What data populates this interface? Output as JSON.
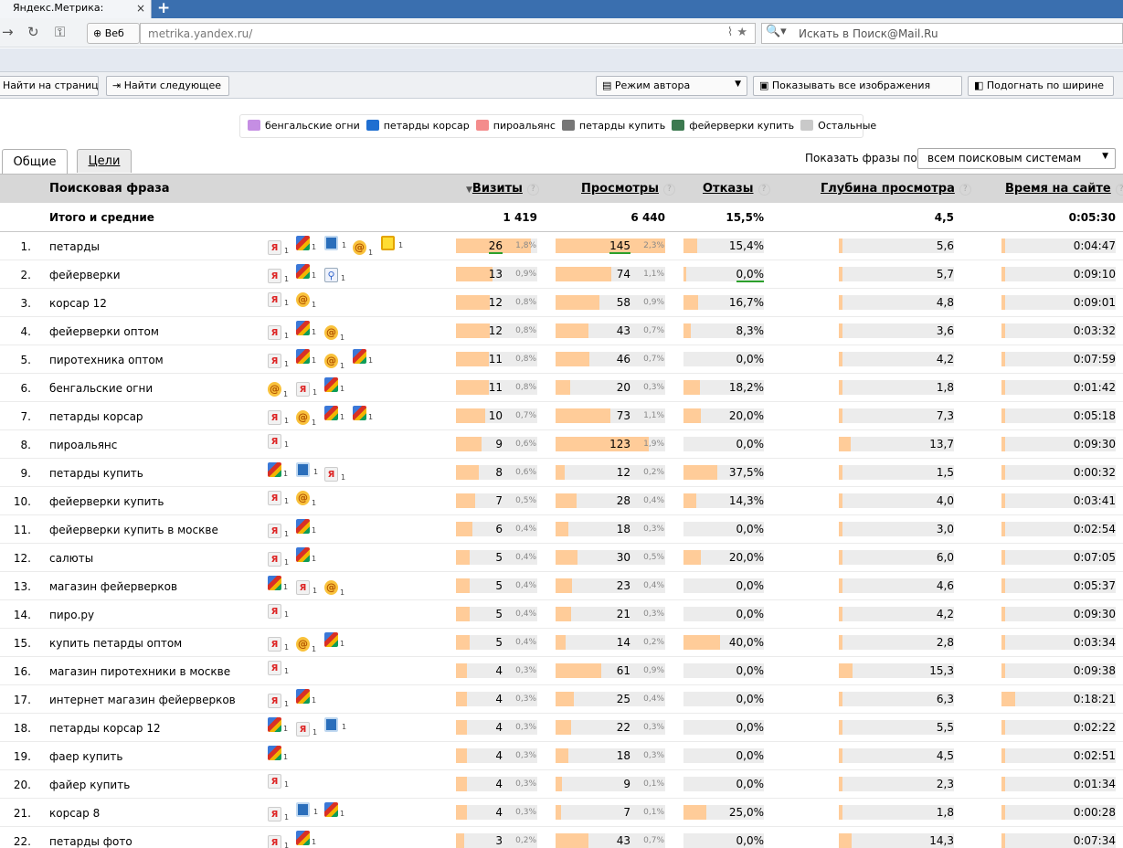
{
  "browser": {
    "tab_title": "Яндекс.Метрика:",
    "tab_close": "×",
    "new_tab": "+",
    "web_button": "Веб",
    "url": "metrika.yandex.ru/",
    "search_placeholder": "Искать в Поиск@Mail.Ru",
    "icons": [
      "forward-icon",
      "reload-icon",
      "key-icon",
      "globe-icon",
      "rss-icon",
      "star-icon",
      "mail-search-icon"
    ]
  },
  "findbar": {
    "input_placeholder": "Найти на странице",
    "find_next": "Найти следующее",
    "author_mode": "Режим автора",
    "show_images": "Показывать все изображения",
    "fit_width": "Подогнать по ширине"
  },
  "legend": [
    {
      "label": "бенгальские огни",
      "color": "#c58ee3"
    },
    {
      "label": "петарды корсар",
      "color": "#1f6fd1"
    },
    {
      "label": "пироальянс",
      "color": "#f48c8c"
    },
    {
      "label": "петарды купить",
      "color": "#777777"
    },
    {
      "label": "фейерверки купить",
      "color": "#3c7a50"
    },
    {
      "label": "Остальные",
      "color": "#c9c9c9"
    }
  ],
  "tabs": {
    "general": "Общие",
    "goals": "Цели"
  },
  "show_phrases": {
    "label": "Показать фразы по",
    "value": "всем поисковым системам"
  },
  "columns": {
    "phrase": "Поисковая фраза",
    "visits": "Визиты",
    "visits_sort": "▼",
    "views": "Просмотры",
    "bounces": "Отказы",
    "depth": "Глубина просмотра",
    "time": "Время на сайте",
    "help": "?"
  },
  "totals": {
    "label": "Итого и средние",
    "visits": "1 419",
    "views": "6 440",
    "bounces": "15,5%",
    "depth": "4,5",
    "time": "0:05:30"
  },
  "rows": [
    {
      "n": "1.",
      "phrase": "петарды",
      "engines": [
        [
          "ya",
          "1"
        ],
        [
          "g",
          "1"
        ],
        [
          "b",
          "1"
        ],
        [
          "m",
          "1"
        ],
        [
          "y",
          "1"
        ]
      ],
      "visits": "26",
      "vp": "1,8%",
      "vf": 0.92,
      "views": "145",
      "wp": "2,3%",
      "wf": 1.0,
      "bounces": "15,4%",
      "bf": 0.17,
      "depth": "5,6",
      "df": 0.03,
      "time": "0:04:47",
      "tf": 0.03,
      "ul": true
    },
    {
      "n": "2.",
      "phrase": "фейерверки",
      "engines": [
        [
          "ya",
          "1"
        ],
        [
          "g",
          "1"
        ],
        [
          "l",
          "1"
        ]
      ],
      "visits": "13",
      "vp": "0,9%",
      "vf": 0.45,
      "views": "74",
      "wp": "1,1%",
      "wf": 0.51,
      "bounces": "0,0%",
      "bf": 0.02,
      "depth": "5,7",
      "df": 0.03,
      "time": "0:09:10",
      "tf": 0.03,
      "ub": true
    },
    {
      "n": "3.",
      "phrase": "корсар 12",
      "engines": [
        [
          "ya",
          "1"
        ],
        [
          "m",
          "1"
        ]
      ],
      "visits": "12",
      "vp": "0,8%",
      "vf": 0.42,
      "views": "58",
      "wp": "0,9%",
      "wf": 0.4,
      "bounces": "16,7%",
      "bf": 0.18,
      "depth": "4,8",
      "df": 0.03,
      "time": "0:09:01",
      "tf": 0.03
    },
    {
      "n": "4.",
      "phrase": "фейерверки оптом",
      "engines": [
        [
          "ya",
          "1"
        ],
        [
          "g",
          "1"
        ],
        [
          "m",
          "1"
        ]
      ],
      "visits": "12",
      "vp": "0,8%",
      "vf": 0.42,
      "views": "43",
      "wp": "0,7%",
      "wf": 0.3,
      "bounces": "8,3%",
      "bf": 0.09,
      "depth": "3,6",
      "df": 0.03,
      "time": "0:03:32",
      "tf": 0.03
    },
    {
      "n": "5.",
      "phrase": "пиротехника оптом",
      "engines": [
        [
          "ya",
          "1"
        ],
        [
          "g",
          "1"
        ],
        [
          "m",
          "1"
        ],
        [
          "g",
          "1"
        ]
      ],
      "visits": "11",
      "vp": "0,8%",
      "vf": 0.4,
      "views": "46",
      "wp": "0,7%",
      "wf": 0.31,
      "bounces": "0,0%",
      "bf": 0.0,
      "depth": "4,2",
      "df": 0.03,
      "time": "0:07:59",
      "tf": 0.03
    },
    {
      "n": "6.",
      "phrase": "бенгальские огни",
      "engines": [
        [
          "m",
          "1"
        ],
        [
          "ya",
          "1"
        ],
        [
          "g",
          "1"
        ]
      ],
      "visits": "11",
      "vp": "0,8%",
      "vf": 0.4,
      "views": "20",
      "wp": "0,3%",
      "wf": 0.13,
      "bounces": "18,2%",
      "bf": 0.2,
      "depth": "1,8",
      "df": 0.03,
      "time": "0:01:42",
      "tf": 0.03
    },
    {
      "n": "7.",
      "phrase": "петарды корсар",
      "engines": [
        [
          "ya",
          "1"
        ],
        [
          "m",
          "1"
        ],
        [
          "g",
          "1"
        ],
        [
          "g",
          "1"
        ]
      ],
      "visits": "10",
      "vp": "0,7%",
      "vf": 0.36,
      "views": "73",
      "wp": "1,1%",
      "wf": 0.5,
      "bounces": "20,0%",
      "bf": 0.22,
      "depth": "7,3",
      "df": 0.03,
      "time": "0:05:18",
      "tf": 0.03
    },
    {
      "n": "8.",
      "phrase": "пироальянс",
      "engines": [
        [
          "ya",
          "1"
        ]
      ],
      "visits": "9",
      "vp": "0,6%",
      "vf": 0.31,
      "views": "123",
      "wp": "1,9%",
      "wf": 0.85,
      "bounces": "0,0%",
      "bf": 0.0,
      "depth": "13,7",
      "df": 0.1,
      "time": "0:09:30",
      "tf": 0.03
    },
    {
      "n": "9.",
      "phrase": "петарды купить",
      "engines": [
        [
          "g",
          "1"
        ],
        [
          "b",
          "1"
        ],
        [
          "ya",
          "1"
        ]
      ],
      "visits": "8",
      "vp": "0,6%",
      "vf": 0.28,
      "views": "12",
      "wp": "0,2%",
      "wf": 0.08,
      "bounces": "37,5%",
      "bf": 0.42,
      "depth": "1,5",
      "df": 0.03,
      "time": "0:00:32",
      "tf": 0.03
    },
    {
      "n": "10.",
      "phrase": "фейерверки купить",
      "engines": [
        [
          "ya",
          "1"
        ],
        [
          "m",
          "1"
        ]
      ],
      "visits": "7",
      "vp": "0,5%",
      "vf": 0.24,
      "views": "28",
      "wp": "0,4%",
      "wf": 0.19,
      "bounces": "14,3%",
      "bf": 0.16,
      "depth": "4,0",
      "df": 0.03,
      "time": "0:03:41",
      "tf": 0.03
    },
    {
      "n": "11.",
      "phrase": "фейерверки купить в москве",
      "engines": [
        [
          "ya",
          "1"
        ],
        [
          "g",
          "1"
        ]
      ],
      "visits": "6",
      "vp": "0,4%",
      "vf": 0.2,
      "views": "18",
      "wp": "0,3%",
      "wf": 0.12,
      "bounces": "0,0%",
      "bf": 0.0,
      "depth": "3,0",
      "df": 0.03,
      "time": "0:02:54",
      "tf": 0.03
    },
    {
      "n": "12.",
      "phrase": "салюты",
      "engines": [
        [
          "ya",
          "1"
        ],
        [
          "g",
          "1"
        ]
      ],
      "visits": "5",
      "vp": "0,4%",
      "vf": 0.17,
      "views": "30",
      "wp": "0,5%",
      "wf": 0.2,
      "bounces": "20,0%",
      "bf": 0.22,
      "depth": "6,0",
      "df": 0.03,
      "time": "0:07:05",
      "tf": 0.03
    },
    {
      "n": "13.",
      "phrase": "магазин фейерверков",
      "engines": [
        [
          "g",
          "1"
        ],
        [
          "ya",
          "1"
        ],
        [
          "m",
          "1"
        ]
      ],
      "visits": "5",
      "vp": "0,4%",
      "vf": 0.17,
      "views": "23",
      "wp": "0,4%",
      "wf": 0.15,
      "bounces": "0,0%",
      "bf": 0.0,
      "depth": "4,6",
      "df": 0.03,
      "time": "0:05:37",
      "tf": 0.03
    },
    {
      "n": "14.",
      "phrase": "пиро.ру",
      "engines": [
        [
          "ya",
          "1"
        ]
      ],
      "visits": "5",
      "vp": "0,4%",
      "vf": 0.17,
      "views": "21",
      "wp": "0,3%",
      "wf": 0.14,
      "bounces": "0,0%",
      "bf": 0.0,
      "depth": "4,2",
      "df": 0.03,
      "time": "0:09:30",
      "tf": 0.03
    },
    {
      "n": "15.",
      "phrase": "купить петарды оптом",
      "engines": [
        [
          "ya",
          "1"
        ],
        [
          "m",
          "1"
        ],
        [
          "g",
          "1"
        ]
      ],
      "visits": "5",
      "vp": "0,4%",
      "vf": 0.17,
      "views": "14",
      "wp": "0,2%",
      "wf": 0.09,
      "bounces": "40,0%",
      "bf": 0.45,
      "depth": "2,8",
      "df": 0.03,
      "time": "0:03:34",
      "tf": 0.03
    },
    {
      "n": "16.",
      "phrase": "магазин пиротехники в москве",
      "engines": [
        [
          "ya",
          "1"
        ]
      ],
      "visits": "4",
      "vp": "0,3%",
      "vf": 0.13,
      "views": "61",
      "wp": "0,9%",
      "wf": 0.42,
      "bounces": "0,0%",
      "bf": 0.0,
      "depth": "15,3",
      "df": 0.12,
      "time": "0:09:38",
      "tf": 0.03
    },
    {
      "n": "17.",
      "phrase": "интернет магазин фейерверков",
      "engines": [
        [
          "ya",
          "1"
        ],
        [
          "g",
          "1"
        ]
      ],
      "visits": "4",
      "vp": "0,3%",
      "vf": 0.13,
      "views": "25",
      "wp": "0,4%",
      "wf": 0.17,
      "bounces": "0,0%",
      "bf": 0.0,
      "depth": "6,3",
      "df": 0.03,
      "time": "0:18:21",
      "tf": 0.12
    },
    {
      "n": "18.",
      "phrase": "петарды корсар 12",
      "engines": [
        [
          "g",
          "1"
        ],
        [
          "ya",
          "1"
        ],
        [
          "b",
          "1"
        ]
      ],
      "visits": "4",
      "vp": "0,3%",
      "vf": 0.13,
      "views": "22",
      "wp": "0,3%",
      "wf": 0.14,
      "bounces": "0,0%",
      "bf": 0.0,
      "depth": "5,5",
      "df": 0.03,
      "time": "0:02:22",
      "tf": 0.03
    },
    {
      "n": "19.",
      "phrase": "фаер купить",
      "engines": [
        [
          "g",
          "1"
        ]
      ],
      "visits": "4",
      "vp": "0,3%",
      "vf": 0.13,
      "views": "18",
      "wp": "0,3%",
      "wf": 0.12,
      "bounces": "0,0%",
      "bf": 0.0,
      "depth": "4,5",
      "df": 0.03,
      "time": "0:02:51",
      "tf": 0.03
    },
    {
      "n": "20.",
      "phrase": "файер купить",
      "engines": [
        [
          "ya",
          "1"
        ]
      ],
      "visits": "4",
      "vp": "0,3%",
      "vf": 0.13,
      "views": "9",
      "wp": "0,1%",
      "wf": 0.06,
      "bounces": "0,0%",
      "bf": 0.0,
      "depth": "2,3",
      "df": 0.03,
      "time": "0:01:34",
      "tf": 0.03
    },
    {
      "n": "21.",
      "phrase": "корсар 8",
      "engines": [
        [
          "ya",
          "1"
        ],
        [
          "b",
          "1"
        ],
        [
          "g",
          "1"
        ]
      ],
      "visits": "4",
      "vp": "0,3%",
      "vf": 0.13,
      "views": "7",
      "wp": "0,1%",
      "wf": 0.05,
      "bounces": "25,0%",
      "bf": 0.28,
      "depth": "1,8",
      "df": 0.03,
      "time": "0:00:28",
      "tf": 0.03
    },
    {
      "n": "22.",
      "phrase": "петарды фото",
      "engines": [
        [
          "ya",
          "1"
        ],
        [
          "g",
          "1"
        ]
      ],
      "visits": "3",
      "vp": "0,2%",
      "vf": 0.1,
      "views": "43",
      "wp": "0,7%",
      "wf": 0.3,
      "bounces": "0,0%",
      "bf": 0.0,
      "depth": "14,3",
      "df": 0.11,
      "time": "0:07:34",
      "tf": 0.03
    }
  ]
}
